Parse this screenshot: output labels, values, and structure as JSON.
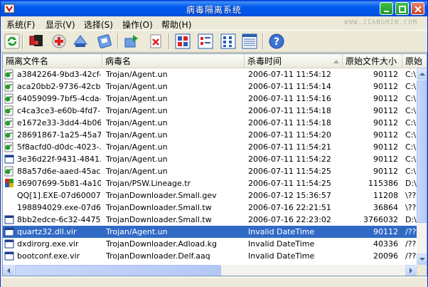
{
  "window": {
    "title": "病毒隔离系统"
  },
  "menu": {
    "items": [
      "系统(F)",
      "显示(V)",
      "选择(S)",
      "操作(O)",
      "帮助(H)"
    ],
    "watermark": "WWW.JIANGMIN.COM"
  },
  "toolbar": {
    "icons": [
      "refresh-icon",
      "scan-icon",
      "delete-icon",
      "restore-icon",
      "export-icon",
      "import-icon",
      "remove-icon",
      "large-icons-view-icon",
      "small-icons-view-icon",
      "list-view-icon",
      "details-view-icon",
      "help-icon"
    ]
  },
  "table": {
    "columns": [
      "隔离文件名",
      "病毒名",
      "杀毒时间",
      "原始文件大小",
      "原始"
    ],
    "rows": [
      {
        "icon": "green-file",
        "name": "a3842264-9bd3-42cf-...",
        "virus": "Trojan/Agent.un",
        "time": "2006-07-11 11:54:12",
        "size": "90112",
        "path": "C:\\"
      },
      {
        "icon": "green-file",
        "name": "aca20bb2-9736-42cb...",
        "virus": "Trojan/Agent.un",
        "time": "2006-07-11 11:54:14",
        "size": "90112",
        "path": "C:\\"
      },
      {
        "icon": "green-file",
        "name": "64059099-7bf5-4cda-...",
        "virus": "Trojan/Agent.un",
        "time": "2006-07-11 11:54:16",
        "size": "90112",
        "path": "C:\\"
      },
      {
        "icon": "green-file",
        "name": "c4ca3ce3-e60b-4fd7-...",
        "virus": "Trojan/Agent.un",
        "time": "2006-07-11 11:54:18",
        "size": "90112",
        "path": "C:\\"
      },
      {
        "icon": "green-file",
        "name": "e1672e33-3dd4-4b06...",
        "virus": "Trojan/Agent.un",
        "time": "2006-07-11 11:54:18",
        "size": "90112",
        "path": "C:\\"
      },
      {
        "icon": "green-file",
        "name": "28691867-1a25-45a7...",
        "virus": "Trojan/Agent.un",
        "time": "2006-07-11 11:54:20",
        "size": "90112",
        "path": "C:\\"
      },
      {
        "icon": "green-file",
        "name": "5f8acfd0-d0dc-4023-...",
        "virus": "Trojan/Agent.un",
        "time": "2006-07-11 11:54:21",
        "size": "90112",
        "path": "C:\\"
      },
      {
        "icon": "window-file",
        "name": "3e36d22f-9431-4841...",
        "virus": "Trojan/Agent.un",
        "time": "2006-07-11 11:54:22",
        "size": "90112",
        "path": "C:\\"
      },
      {
        "icon": "green-file",
        "name": "88a57d6e-aaed-45ac...",
        "virus": "Trojan/Agent.un",
        "time": "2006-07-11 11:54:25",
        "size": "90112",
        "path": "C:\\"
      },
      {
        "icon": "color-file",
        "name": "36907699-5b81-4a10...",
        "virus": "Trojan/PSW.Lineage.tr",
        "time": "2006-07-11 11:54:25",
        "size": "115386",
        "path": "D:\\"
      },
      {
        "icon": "none",
        "name": "QQ[1].EXE-07d60007...",
        "virus": "TrojanDownloader.Small.gev",
        "time": "2006-07-12 15:36:57",
        "size": "11208",
        "path": "\\??"
      },
      {
        "icon": "none",
        "name": "198894029.exe-07d6...",
        "virus": "TrojanDownloader.Small.tw",
        "time": "2006-07-16 22:21:51",
        "size": "36864",
        "path": "\\??"
      },
      {
        "icon": "window-file",
        "name": "8bb2edce-6c32-4475...",
        "virus": "TrojanDownloader.Small.tw",
        "time": "2006-07-16 22:23:02",
        "size": "3766032",
        "path": "D:\\"
      },
      {
        "icon": "window-file",
        "name": "quartz32.dll.vir",
        "virus": "Trojan/Agent.un",
        "time": "Invalid DateTime",
        "size": "90112",
        "path": "/??",
        "selected": true
      },
      {
        "icon": "window-file",
        "name": "dxdirorg.exe.vir",
        "virus": "TrojanDownloader.Adload.kg",
        "time": "Invalid DateTime",
        "size": "40336",
        "path": "/??"
      },
      {
        "icon": "window-file",
        "name": "bootconf.exe.vir",
        "virus": "TrojanDownloader.Delf.aaq",
        "time": "Invalid DateTime",
        "size": "20096",
        "path": "/??"
      }
    ]
  },
  "colors": {
    "titlebar": "#0054e3",
    "selection": "#316ac5",
    "face": "#ece9d8"
  }
}
